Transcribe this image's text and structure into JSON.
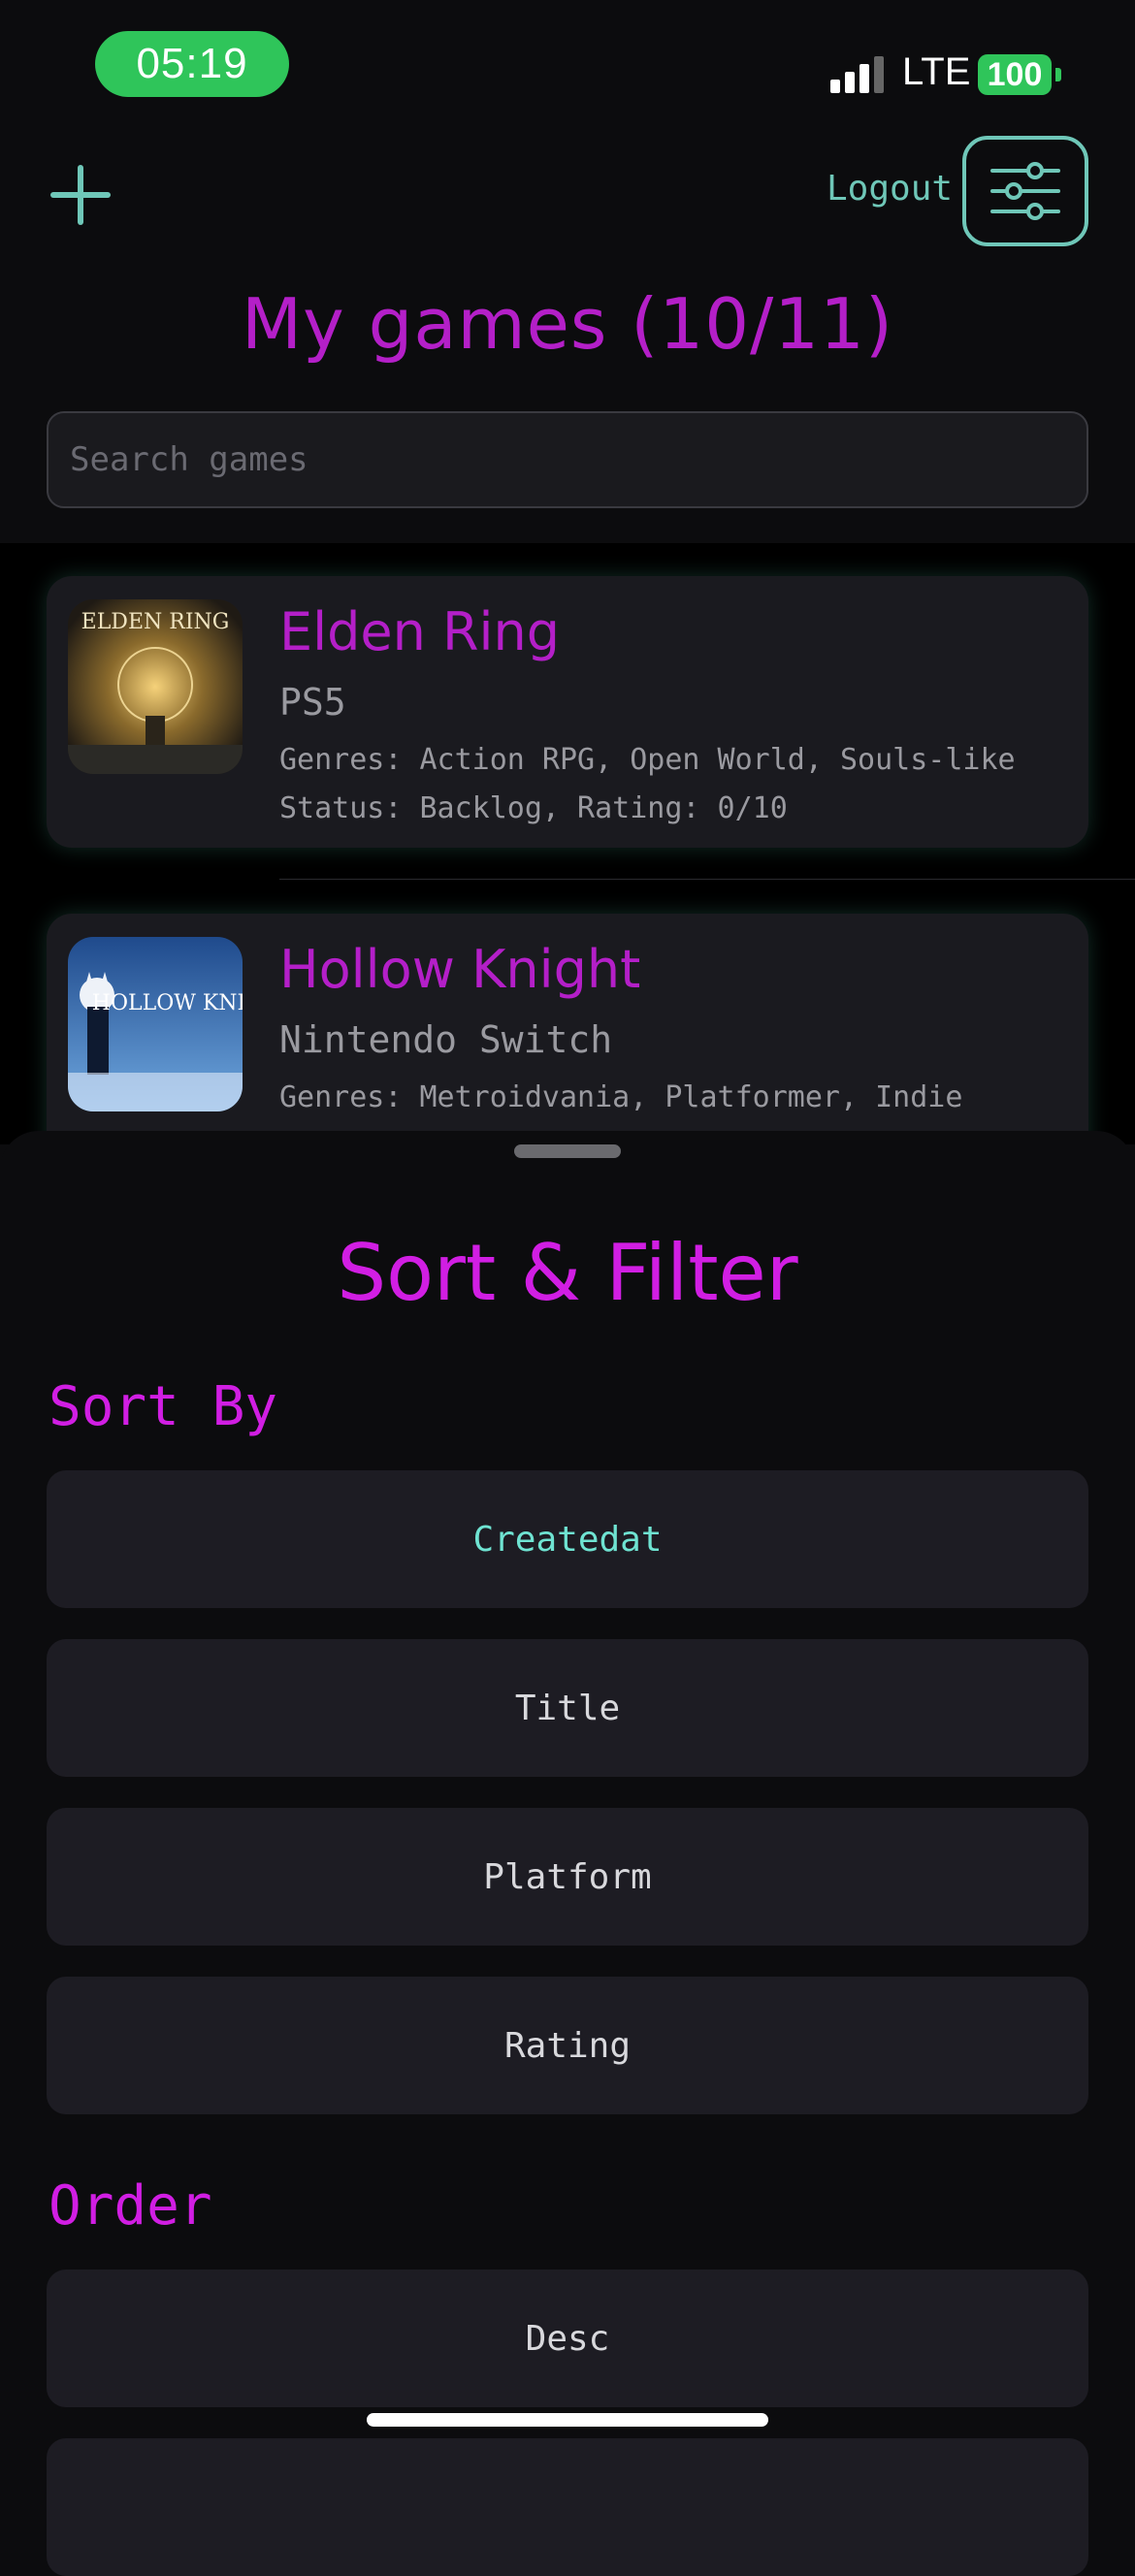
{
  "status_bar": {
    "time": "05:19",
    "network": "LTE",
    "battery": "100"
  },
  "header": {
    "logout_label": "Logout",
    "title": "My games (10/11)",
    "search_placeholder": "Search games"
  },
  "games": [
    {
      "title": "Elden Ring",
      "platform": "PS5",
      "genres": "Genres: Action RPG, Open World, Souls-like",
      "status": "Status: Backlog, Rating: 0/10",
      "cover_text": "ELDEN RING"
    },
    {
      "title": "Hollow Knight",
      "platform": "Nintendo Switch",
      "genres": "Genres: Metroidvania, Platformer, Indie",
      "cover_text": "HOLLOW KNI"
    }
  ],
  "sheet": {
    "title": "Sort & Filter",
    "sort_by_label": "Sort By",
    "sort_options": [
      "Createdat",
      "Title",
      "Platform",
      "Rating"
    ],
    "selected_sort": "Createdat",
    "order_label": "Order",
    "order_options": [
      "Desc"
    ]
  },
  "colors": {
    "accent_magenta": "#d11ee3",
    "accent_teal": "#6fc7b8",
    "background": "#0c0c0e"
  }
}
